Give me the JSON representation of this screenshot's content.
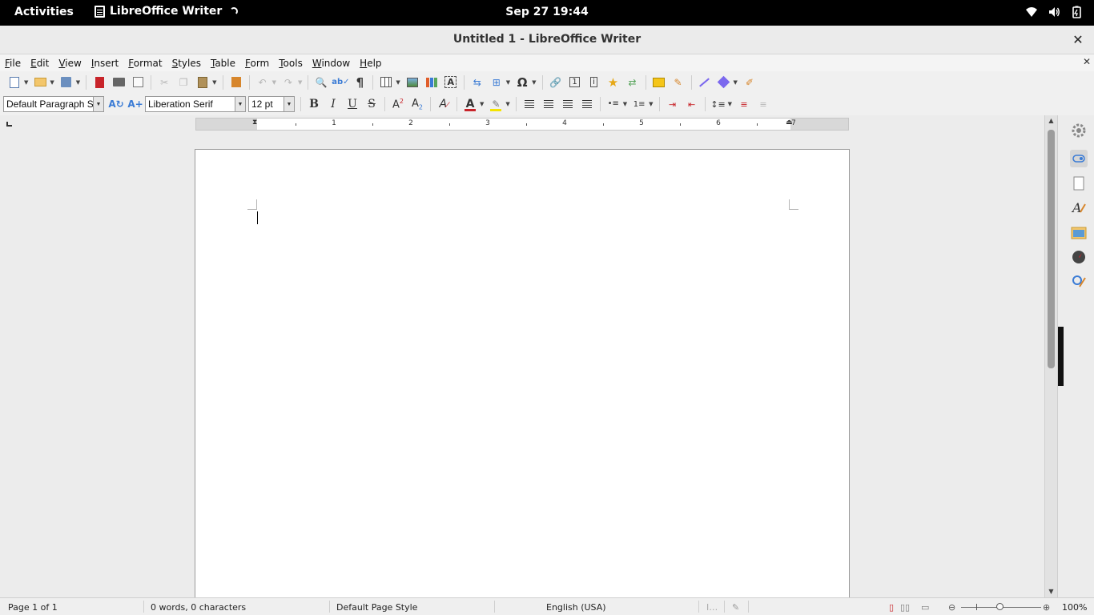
{
  "system_bar": {
    "activities": "Activities",
    "app_name": "LibreOffice Writer",
    "clock": "Sep 27  19:44",
    "icons": [
      "wifi-icon",
      "volume-icon",
      "battery-icon"
    ]
  },
  "window": {
    "title": "Untitled 1 - LibreOffice Writer",
    "close_glyph": "✕"
  },
  "menubar": {
    "items": [
      "File",
      "Edit",
      "View",
      "Insert",
      "Format",
      "Styles",
      "Table",
      "Form",
      "Tools",
      "Window",
      "Help"
    ],
    "close_doc_glyph": "✕"
  },
  "formatting": {
    "paragraph_style": "Default Paragraph Sty",
    "font_name": "Liberation Serif",
    "font_size": "12 pt",
    "bold": "B",
    "italic": "I",
    "underline": "U",
    "strikethrough": "S",
    "font_color": "#c8242a",
    "highlight_color": "#f5e400"
  },
  "ruler": {
    "numbers": [
      "1",
      "2",
      "3",
      "4",
      "5",
      "6",
      "7"
    ]
  },
  "document": {
    "body_text": ""
  },
  "status": {
    "page": "Page 1 of 1",
    "words": "0 words, 0 characters",
    "page_style": "Default Page Style",
    "language": "English (USA)",
    "zoom": "100%",
    "zoom_level": 100
  },
  "colors": {
    "accent": "#3a7bd5",
    "topbar": "#000000"
  }
}
